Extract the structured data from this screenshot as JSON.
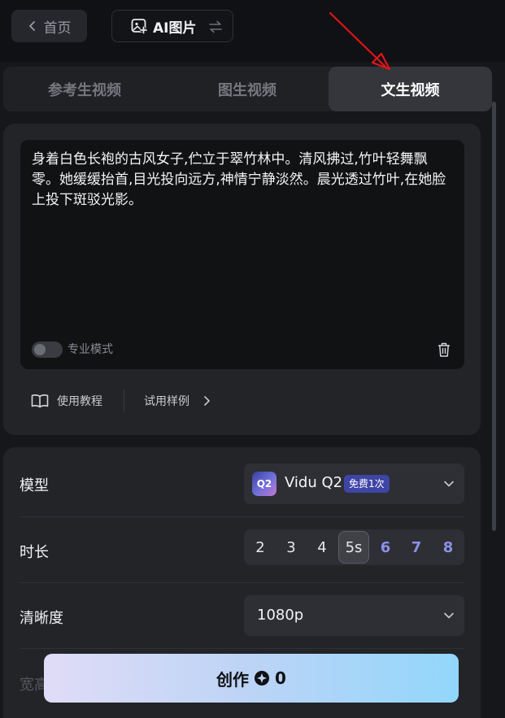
{
  "topbar": {
    "home_label": "首页",
    "ai_image_label": "AI图片"
  },
  "tabs": [
    {
      "label": "参考生视频",
      "active": false
    },
    {
      "label": "图生视频",
      "active": false
    },
    {
      "label": "文生视频",
      "active": true
    }
  ],
  "prompt": {
    "text": "身着白色长袍的古风女子,伫立于翠竹林中。清风拂过,竹叶轻舞飘零。她缓缓抬首,目光投向远方,神情宁静淡然。晨光透过竹叶,在她脸上投下斑驳光影。",
    "pro_mode_label": "专业模式",
    "pro_mode_on": false
  },
  "helpers": {
    "tutorial_label": "使用教程",
    "sample_label": "试用样例"
  },
  "settings": {
    "model_label": "模型",
    "model_badge": "Q2",
    "model_name": "Vidu Q2",
    "model_free_tag": "免费1次",
    "duration_label": "时长",
    "duration_options": [
      "2",
      "3",
      "4",
      "5s",
      "6",
      "7",
      "8"
    ],
    "duration_selected": "5s",
    "resolution_label": "清晰度",
    "resolution_value": "1080p",
    "partial_label": "宽高"
  },
  "create": {
    "label": "创作",
    "cost": "0"
  },
  "colors": {
    "accent_blue": "#8b90e8",
    "annotation_red": "#e0141a",
    "create_gradient_start": "#e0dcf7",
    "create_gradient_end": "#91d7fb"
  }
}
